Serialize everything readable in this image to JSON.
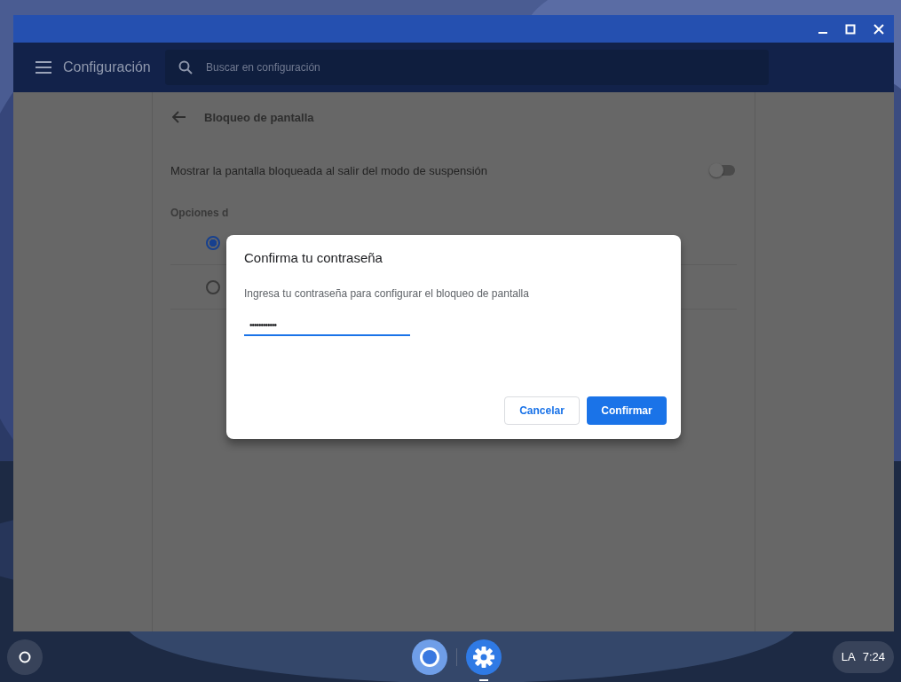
{
  "header": {
    "title": "Configuración",
    "search_placeholder": "Buscar en configuración"
  },
  "page": {
    "title": "Bloqueo de pantalla",
    "setting": {
      "label": "Mostrar la pantalla bloqueada al salir del modo de suspensión",
      "on": false
    },
    "section_heading": "Opciones d",
    "options": [
      {
        "selected": true
      },
      {
        "selected": false
      }
    ]
  },
  "dialog": {
    "title": "Confirma tu contraseña",
    "message": "Ingresa tu contraseña para configurar el bloqueo de pantalla",
    "password": "••••••••••••",
    "buttons": [
      {
        "label": "Cancelar",
        "kind": "secondary"
      },
      {
        "label": "Confirmar",
        "kind": "primary"
      }
    ]
  },
  "shelf": {
    "apps": [
      {
        "kind": "browser",
        "selected": false
      },
      {
        "kind": "settings",
        "selected": true
      }
    ],
    "status": {
      "locale": "LA",
      "time": "7:24"
    }
  }
}
